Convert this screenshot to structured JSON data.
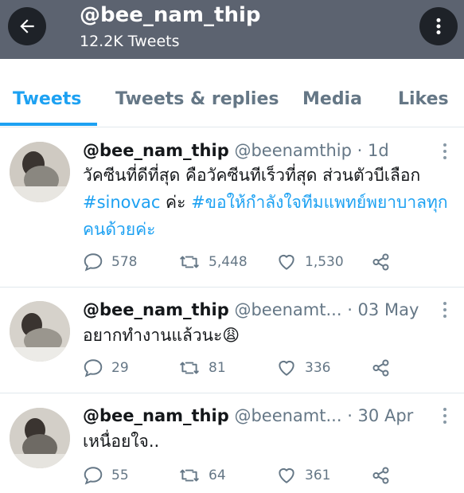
{
  "header": {
    "name": "@bee_nam_thip",
    "tweet_count": "12.2K Tweets",
    "icons": {
      "back": "arrow-left-icon",
      "more": "more-vertical-icon"
    }
  },
  "tabs": [
    {
      "label": "Tweets",
      "active": true
    },
    {
      "label": "Tweets & replies",
      "active": false
    },
    {
      "label": "Media",
      "active": false
    },
    {
      "label": "Likes",
      "active": false
    }
  ],
  "tweets": [
    {
      "name": "@bee_nam_thip",
      "handle": "@beenamthip",
      "time": "· 1d",
      "text_parts": [
        {
          "text": "วัคซีนที่ดีที่สุด คือวัคซีนทีเร็วที่สุด ส่วนตัวบีเลือก ",
          "tag": false
        },
        {
          "text": "#sinovac",
          "tag": true
        },
        {
          "text": " ค่ะ ",
          "tag": false
        },
        {
          "text": "#ขอให้กำลังใจทีมแพทย์พยาบาลทุกคนด้วยค่ะ",
          "tag": true
        }
      ],
      "replies": "578",
      "retweets": "5,448",
      "likes": "1,530"
    },
    {
      "name": "@bee_nam_thip",
      "handle": "@beenamt...",
      "time": "· 03 May",
      "text_parts": [
        {
          "text": "อยากทำงานแล้วนะ",
          "tag": false
        },
        {
          "text": "😩",
          "tag": false
        }
      ],
      "replies": "29",
      "retweets": "81",
      "likes": "336"
    },
    {
      "name": "@bee_nam_thip",
      "handle": "@beenamt...",
      "time": "· 30 Apr",
      "text_parts": [
        {
          "text": "เหนื่อยใจ..",
          "tag": false
        }
      ],
      "replies": "55",
      "retweets": "64",
      "likes": "361"
    }
  ],
  "colors": {
    "accent": "#1da1f2",
    "header_bg": "#5c6370",
    "muted": "#657786"
  }
}
